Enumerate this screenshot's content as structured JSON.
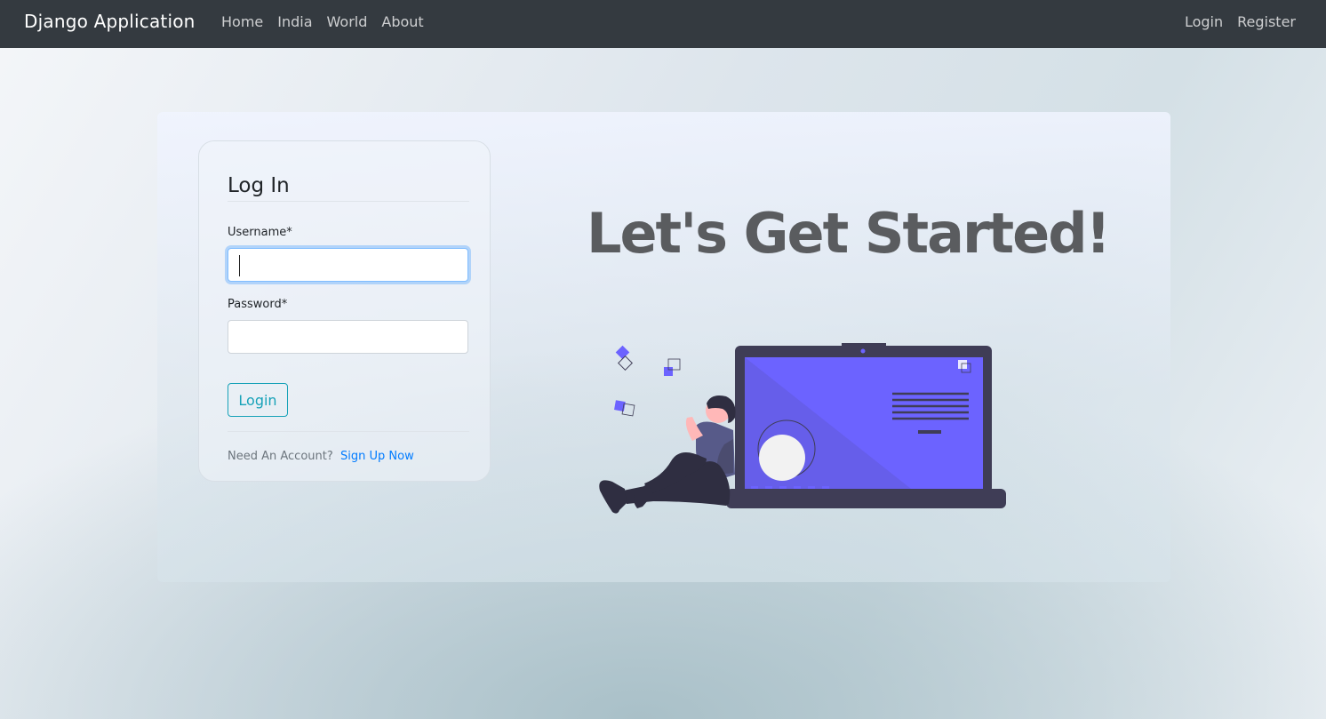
{
  "navbar": {
    "brand": "Django Application",
    "links": [
      "Home",
      "India",
      "World",
      "About"
    ],
    "auth_links": [
      "Login",
      "Register"
    ]
  },
  "login_form": {
    "title": "Log In",
    "username_label": "Username*",
    "username_value": "",
    "password_label": "Password*",
    "password_value": "",
    "submit_label": "Login",
    "footer_text": "Need An Account?",
    "signup_link": "Sign Up Now"
  },
  "hero": {
    "headline": "Let's Get Started!"
  },
  "colors": {
    "navbar_bg": "#343a40",
    "accent_info": "#17a2b8",
    "link_blue": "#007bff",
    "illustration_purple": "#6c63ff",
    "laptop_dark": "#3f3d56"
  },
  "icons": {
    "illustration": "person-with-laptop-illustration"
  }
}
